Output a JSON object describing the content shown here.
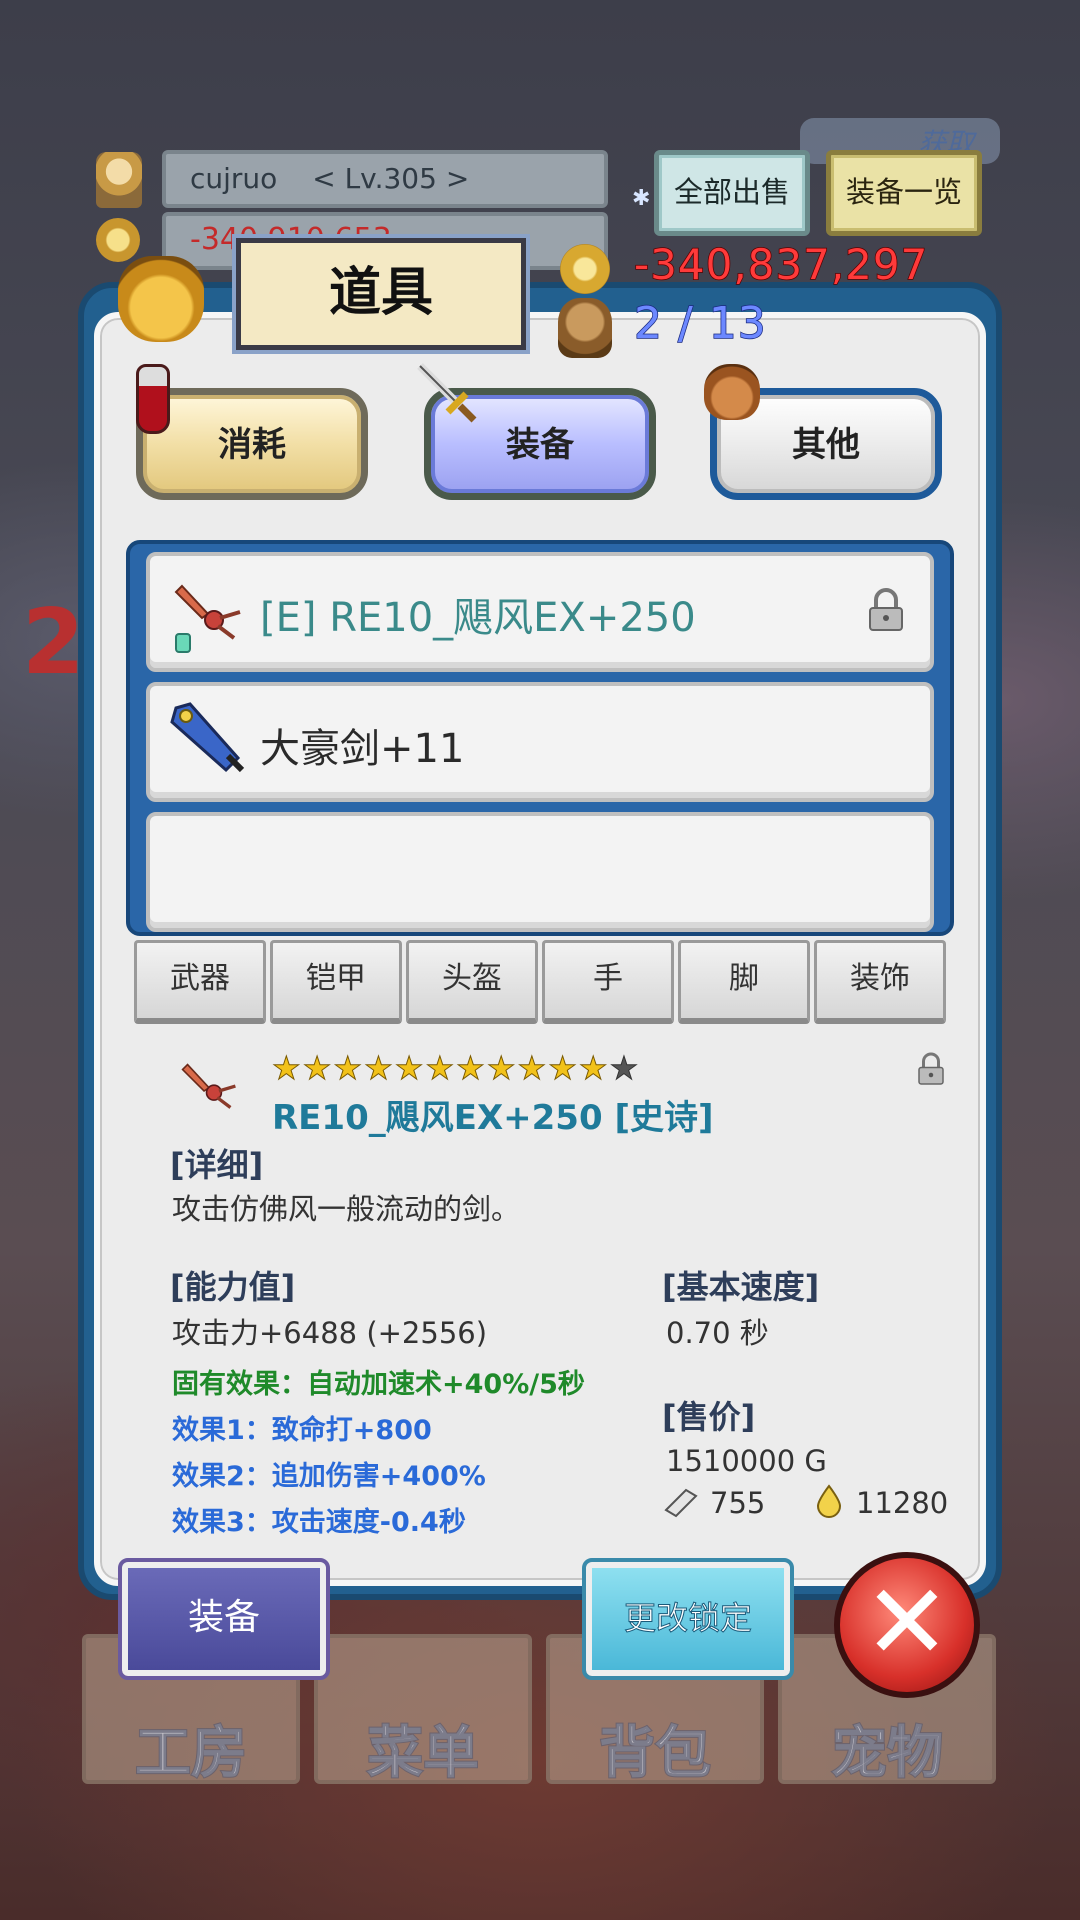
{
  "player": {
    "name": "cujruo",
    "level": "< Lv.305 >",
    "gold_partial": "-340,910,653"
  },
  "top_buttons": {
    "sell_all": "全部出售",
    "equipment_list": "装备一览",
    "obtain_badge": "获取"
  },
  "panel": {
    "title": "道具",
    "gold": "-340,837,297",
    "capacity": "2 / 13"
  },
  "category_tabs": [
    {
      "label": "消耗",
      "icon": "potion-icon"
    },
    {
      "label": "装备",
      "icon": "sword-icon",
      "selected": true
    },
    {
      "label": "其他",
      "icon": "sack-icon"
    }
  ],
  "items": [
    {
      "label": "[E] RE10_飓风EX+250",
      "locked": true,
      "color": "#3a8a8a"
    },
    {
      "label": "大豪剑+11",
      "locked": false,
      "color": "#2a2a2a"
    },
    {
      "label": ""
    }
  ],
  "filters": [
    "武器",
    "铠甲",
    "头盔",
    "手",
    "脚",
    "装饰"
  ],
  "detail": {
    "stars_filled": 11,
    "stars_total": 12,
    "name": "RE10_飓风EX+250 [史诗]",
    "section_detail": "[详细]",
    "description": "攻击仿佛风一般流动的剑。",
    "section_stats": "[能力值]",
    "attack": "攻击力+6488 (+2556)",
    "intrinsic": "固有效果：自动加速术+40%/5秒",
    "effect1": "效果1：致命打+800",
    "effect2": "效果2：追加伤害+400%",
    "effect3": "效果3：攻击速度-0.4秒",
    "section_speed": "[基本速度]",
    "speed": "0.70 秒",
    "section_price": "[售价]",
    "price": "1510000 G",
    "material1": "755",
    "material2": "11280"
  },
  "bottom_buttons": {
    "equip": "装备",
    "change_lock": "更改锁定",
    "close": "✕"
  },
  "background_nav": [
    "工房",
    "菜单",
    "背包",
    "宠物"
  ],
  "background_number": "2"
}
